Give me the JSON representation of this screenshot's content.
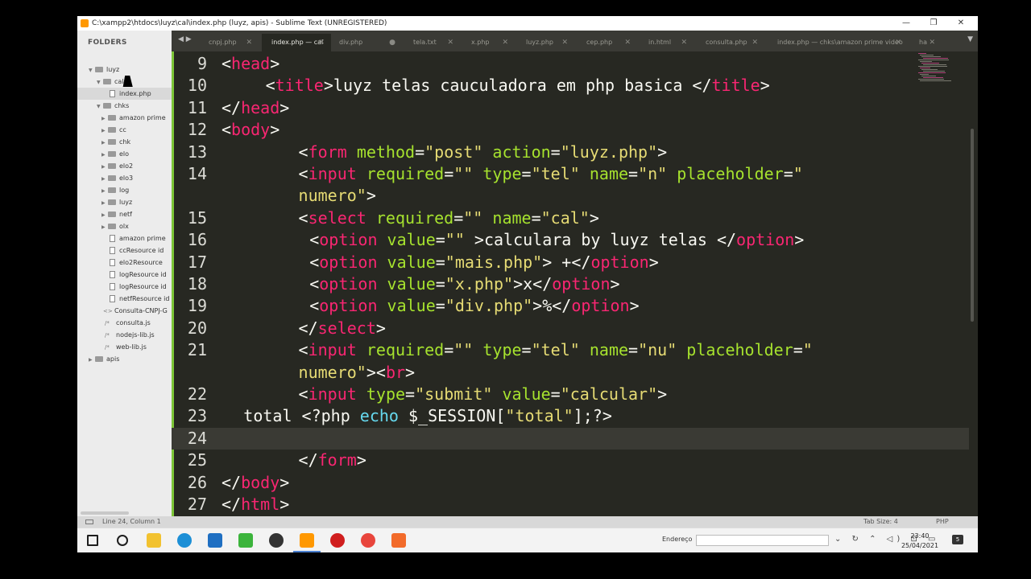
{
  "window": {
    "title": "C:\\xampp2\\htdocs\\luyz\\cal\\index.php (luyz, apis) - Sublime Text (UNREGISTERED)",
    "minimize_icon": "—",
    "maximize_icon": "❐",
    "close_icon": "✕"
  },
  "sidebar": {
    "header": "FOLDERS",
    "items": [
      {
        "label": "luyz",
        "type": "folder",
        "expanded": true
      },
      {
        "label": "cal",
        "type": "folder",
        "expanded": true
      },
      {
        "label": "index.php",
        "type": "file",
        "selected": true
      },
      {
        "label": "chks",
        "type": "folder",
        "expanded": true
      },
      {
        "label": "amazon prime",
        "type": "folder"
      },
      {
        "label": "cc",
        "type": "folder"
      },
      {
        "label": "chk",
        "type": "folder"
      },
      {
        "label": "elo",
        "type": "folder"
      },
      {
        "label": "elo2",
        "type": "folder"
      },
      {
        "label": "elo3",
        "type": "folder"
      },
      {
        "label": "log",
        "type": "folder"
      },
      {
        "label": "luyz",
        "type": "folder"
      },
      {
        "label": "netf",
        "type": "folder"
      },
      {
        "label": "olx",
        "type": "folder"
      },
      {
        "label": "amazon prime",
        "type": "file"
      },
      {
        "label": "ccResource id",
        "type": "file"
      },
      {
        "label": "elo2Resource",
        "type": "file"
      },
      {
        "label": "logResource id",
        "type": "file"
      },
      {
        "label": "logResource id",
        "type": "file"
      },
      {
        "label": "netfResource id",
        "type": "file"
      },
      {
        "label": "Consulta-CNPJ-G",
        "type": "code"
      },
      {
        "label": "consulta.js",
        "type": "js"
      },
      {
        "label": "nodejs-lib.js",
        "type": "js"
      },
      {
        "label": "web-lib.js",
        "type": "js"
      },
      {
        "label": "apis",
        "type": "folder"
      }
    ]
  },
  "tabs": {
    "nav": "◀ ▶",
    "dropdown": "▼",
    "items": [
      {
        "label": "cnpj.php",
        "close": "✕"
      },
      {
        "label": "index.php — cal",
        "close": "✕",
        "active": true
      },
      {
        "label": "div.php",
        "close": "●"
      },
      {
        "label": "tela.txt",
        "close": "✕"
      },
      {
        "label": "x.php",
        "close": "✕"
      },
      {
        "label": "luyz.php",
        "close": "✕"
      },
      {
        "label": "cep.php",
        "close": "✕"
      },
      {
        "label": "in.html",
        "close": "✕"
      },
      {
        "label": "consulta.php",
        "close": "✕"
      },
      {
        "label": "index.php — chks\\amazon prime video",
        "close": "✕"
      },
      {
        "label": "ha",
        "close": "✕"
      }
    ]
  },
  "editor": {
    "current_line": "24",
    "lines": [
      {
        "n": "9",
        "indent": 0,
        "tokens": [
          [
            "p",
            "<"
          ],
          [
            "tg",
            "head"
          ],
          [
            "p",
            ">"
          ]
        ]
      },
      {
        "n": "10",
        "indent": 4,
        "tokens": [
          [
            "p",
            "<"
          ],
          [
            "tg",
            "title"
          ],
          [
            "p",
            ">luyz telas cauculadora em php basica </"
          ],
          [
            "tg",
            "title"
          ],
          [
            "p",
            ">"
          ]
        ]
      },
      {
        "n": "11",
        "indent": 0,
        "tokens": [
          [
            "p",
            "</"
          ],
          [
            "tg",
            "head"
          ],
          [
            "p",
            ">"
          ]
        ]
      },
      {
        "n": "12",
        "indent": 0,
        "tokens": [
          [
            "p",
            "<"
          ],
          [
            "tg",
            "body"
          ],
          [
            "p",
            ">"
          ]
        ]
      },
      {
        "n": "13",
        "indent": 7,
        "tokens": [
          [
            "p",
            "<"
          ],
          [
            "tg",
            "form"
          ],
          [
            "p",
            " "
          ],
          [
            "at",
            "method"
          ],
          [
            "p",
            "="
          ],
          [
            "st",
            "\"post\""
          ],
          [
            "p",
            " "
          ],
          [
            "at",
            "action"
          ],
          [
            "p",
            "="
          ],
          [
            "st",
            "\"luyz.php\""
          ],
          [
            "p",
            ">"
          ]
        ]
      },
      {
        "n": "14",
        "indent": 7,
        "tokens": [
          [
            "p",
            "<"
          ],
          [
            "tg",
            "input"
          ],
          [
            "p",
            " "
          ],
          [
            "at",
            "required"
          ],
          [
            "p",
            "="
          ],
          [
            "st",
            "\"\""
          ],
          [
            "p",
            " "
          ],
          [
            "at",
            "type"
          ],
          [
            "p",
            "="
          ],
          [
            "st",
            "\"tel\""
          ],
          [
            "p",
            " "
          ],
          [
            "at",
            "name"
          ],
          [
            "p",
            "="
          ],
          [
            "st",
            "\"n\""
          ],
          [
            "p",
            " "
          ],
          [
            "at",
            "placeholder"
          ],
          [
            "p",
            "="
          ],
          [
            "st",
            "\""
          ]
        ]
      },
      {
        "n": "",
        "indent": 7,
        "tokens": [
          [
            "st",
            "numero\""
          ],
          [
            "p",
            ">"
          ]
        ]
      },
      {
        "n": "15",
        "indent": 7,
        "tokens": [
          [
            "p",
            "<"
          ],
          [
            "tg",
            "select"
          ],
          [
            "p",
            " "
          ],
          [
            "at",
            "required"
          ],
          [
            "p",
            "="
          ],
          [
            "st",
            "\"\""
          ],
          [
            "p",
            " "
          ],
          [
            "at",
            "name"
          ],
          [
            "p",
            "="
          ],
          [
            "st",
            "\"cal\""
          ],
          [
            "p",
            ">"
          ]
        ]
      },
      {
        "n": "16",
        "indent": 8,
        "tokens": [
          [
            "p",
            "<"
          ],
          [
            "tg",
            "option"
          ],
          [
            "p",
            " "
          ],
          [
            "at",
            "value"
          ],
          [
            "p",
            "="
          ],
          [
            "st",
            "\"\""
          ],
          [
            "p",
            " >calculara by luyz telas </"
          ],
          [
            "tg",
            "option"
          ],
          [
            "p",
            ">"
          ]
        ]
      },
      {
        "n": "17",
        "indent": 8,
        "tokens": [
          [
            "p",
            "<"
          ],
          [
            "tg",
            "option"
          ],
          [
            "p",
            " "
          ],
          [
            "at",
            "value"
          ],
          [
            "p",
            "="
          ],
          [
            "st",
            "\"mais.php\""
          ],
          [
            "p",
            "> +</"
          ],
          [
            "tg",
            "option"
          ],
          [
            "p",
            ">"
          ]
        ]
      },
      {
        "n": "18",
        "indent": 8,
        "tokens": [
          [
            "p",
            "<"
          ],
          [
            "tg",
            "option"
          ],
          [
            "p",
            " "
          ],
          [
            "at",
            "value"
          ],
          [
            "p",
            "="
          ],
          [
            "st",
            "\"x.php\""
          ],
          [
            "p",
            ">x</"
          ],
          [
            "tg",
            "option"
          ],
          [
            "p",
            ">"
          ]
        ]
      },
      {
        "n": "19",
        "indent": 8,
        "tokens": [
          [
            "p",
            "<"
          ],
          [
            "tg",
            "option"
          ],
          [
            "p",
            " "
          ],
          [
            "at",
            "value"
          ],
          [
            "p",
            "="
          ],
          [
            "st",
            "\"div.php\""
          ],
          [
            "p",
            ">%</"
          ],
          [
            "tg",
            "option"
          ],
          [
            "p",
            ">"
          ]
        ]
      },
      {
        "n": "20",
        "indent": 7,
        "tokens": [
          [
            "p",
            "</"
          ],
          [
            "tg",
            "select"
          ],
          [
            "p",
            ">"
          ]
        ]
      },
      {
        "n": "21",
        "indent": 7,
        "tokens": [
          [
            "p",
            "<"
          ],
          [
            "tg",
            "input"
          ],
          [
            "p",
            " "
          ],
          [
            "at",
            "required"
          ],
          [
            "p",
            "="
          ],
          [
            "st",
            "\"\""
          ],
          [
            "p",
            " "
          ],
          [
            "at",
            "type"
          ],
          [
            "p",
            "="
          ],
          [
            "st",
            "\"tel\""
          ],
          [
            "p",
            " "
          ],
          [
            "at",
            "name"
          ],
          [
            "p",
            "="
          ],
          [
            "st",
            "\"nu\""
          ],
          [
            "p",
            " "
          ],
          [
            "at",
            "placeholder"
          ],
          [
            "p",
            "="
          ],
          [
            "st",
            "\""
          ]
        ]
      },
      {
        "n": "",
        "indent": 7,
        "tokens": [
          [
            "st",
            "numero\""
          ],
          [
            "p",
            ">"
          ],
          [
            "p",
            "<"
          ],
          [
            "tg",
            "br"
          ],
          [
            "p",
            ">"
          ]
        ]
      },
      {
        "n": "22",
        "indent": 7,
        "tokens": [
          [
            "p",
            "<"
          ],
          [
            "tg",
            "input"
          ],
          [
            "p",
            " "
          ],
          [
            "at",
            "type"
          ],
          [
            "p",
            "="
          ],
          [
            "st",
            "\"submit\""
          ],
          [
            "p",
            " "
          ],
          [
            "at",
            "value"
          ],
          [
            "p",
            "="
          ],
          [
            "st",
            "\"calcular\""
          ],
          [
            "p",
            ">"
          ]
        ]
      },
      {
        "n": "23",
        "indent": 2,
        "tokens": [
          [
            "p",
            "total <?php "
          ],
          [
            "kw",
            "echo"
          ],
          [
            "p",
            " $_SESSION["
          ],
          [
            "st",
            "\"total\""
          ],
          [
            "p",
            "];?>"
          ]
        ]
      },
      {
        "n": "24",
        "indent": 0,
        "tokens": []
      },
      {
        "n": "25",
        "indent": 7,
        "tokens": [
          [
            "p",
            "</"
          ],
          [
            "tg",
            "form"
          ],
          [
            "p",
            ">"
          ]
        ]
      },
      {
        "n": "26",
        "indent": 0,
        "tokens": [
          [
            "p",
            "</"
          ],
          [
            "tg",
            "body"
          ],
          [
            "p",
            ">"
          ]
        ]
      },
      {
        "n": "27",
        "indent": 0,
        "tokens": [
          [
            "p",
            "</"
          ],
          [
            "tg",
            "html"
          ],
          [
            "p",
            ">"
          ]
        ]
      }
    ]
  },
  "statusbar": {
    "position": "Line 24, Column 1",
    "tab_size": "Tab Size: 4",
    "syntax": "PHP"
  },
  "taskbar": {
    "address_label": "Endereço",
    "address_value": "",
    "time": "23:40",
    "date": "25/04/2021",
    "notification_count": "5",
    "tray_icons": "⌄ ↻ ⌃ ◁) ⊡ ▭",
    "apps": [
      {
        "name": "windows-start-icon",
        "color": "#1e1e1e"
      },
      {
        "name": "search-icon",
        "color": "#1e1e1e"
      },
      {
        "name": "file-explorer-icon",
        "color": "#f2c230"
      },
      {
        "name": "edge-icon",
        "color": "#1d8fd6"
      },
      {
        "name": "vscode-icon",
        "color": "#1f6fc2"
      },
      {
        "name": "git-icon",
        "color": "#3cb43c"
      },
      {
        "name": "obs-icon",
        "color": "#333333"
      },
      {
        "name": "sublime-text-icon",
        "color": "#ff9800",
        "active": true
      },
      {
        "name": "media-player-icon",
        "color": "#d01e1e"
      },
      {
        "name": "chrome-icon",
        "color": "#e8453c"
      },
      {
        "name": "xampp-icon",
        "color": "#f26b2a"
      }
    ]
  }
}
